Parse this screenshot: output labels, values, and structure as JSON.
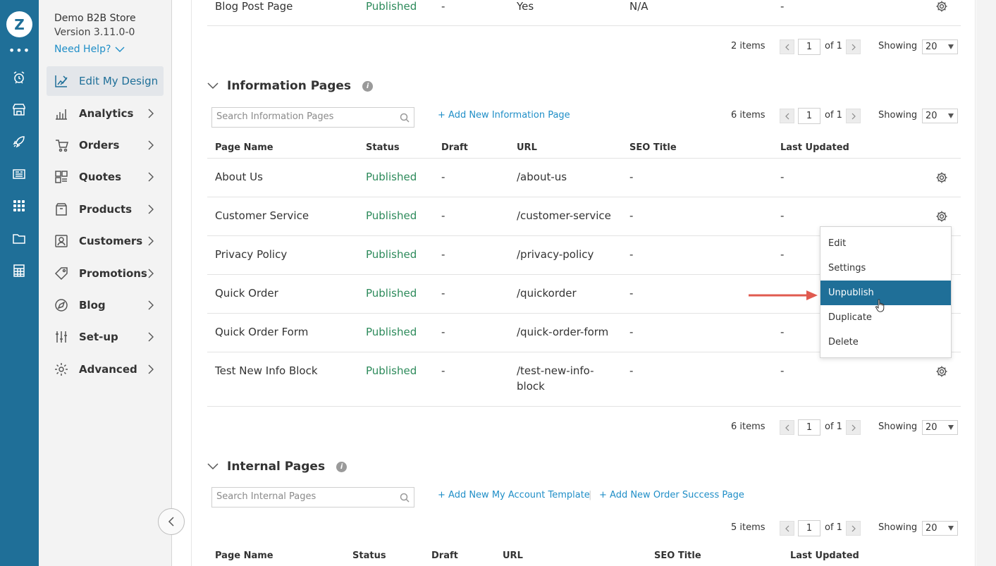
{
  "rail": {
    "logo": "Z",
    "more": "•••",
    "icons": [
      "alarm-icon",
      "storefront-icon",
      "rocket-icon",
      "newspaper-icon",
      "apps-grid-icon",
      "folder-icon",
      "spreadsheet-icon"
    ]
  },
  "sidebar": {
    "store_name": "Demo B2B Store",
    "version": "Version 3.11.0-0",
    "help": "Need Help?",
    "items": [
      {
        "label": "Edit My Design",
        "icon": "design-icon",
        "active": true
      },
      {
        "label": "Analytics",
        "icon": "bar-chart-icon"
      },
      {
        "label": "Orders",
        "icon": "orders-icon"
      },
      {
        "label": "Quotes",
        "icon": "quotes-icon"
      },
      {
        "label": "Products",
        "icon": "box-icon"
      },
      {
        "label": "Customers",
        "icon": "customers-icon"
      },
      {
        "label": "Promotions",
        "icon": "tag-icon"
      },
      {
        "label": "Blog",
        "icon": "blog-icon"
      },
      {
        "label": "Set-up",
        "icon": "sliders-icon"
      },
      {
        "label": "Advanced",
        "icon": "gear-icon"
      }
    ]
  },
  "blog_section": {
    "row": {
      "name": "Blog Post Page",
      "status": "Published",
      "draft": "-",
      "url": "Yes",
      "seo": "N/A",
      "updated": "-"
    },
    "pager": {
      "items": "2 items",
      "page": "1",
      "of": "of 1",
      "showing": "Showing",
      "per_page": "20"
    }
  },
  "info_section": {
    "title": "Information Pages",
    "info_icon": "i",
    "search_placeholder": "Search Information Pages",
    "add_link": "+ Add New Information Page",
    "pager": {
      "items": "6 items",
      "page": "1",
      "of": "of 1",
      "showing": "Showing",
      "per_page": "20"
    },
    "headers": [
      "Page Name",
      "Status",
      "Draft",
      "URL",
      "SEO Title",
      "Last Updated"
    ],
    "rows": [
      {
        "name": "About Us",
        "status": "Published",
        "draft": "-",
        "url": "/about-us",
        "seo": "-",
        "updated": "-"
      },
      {
        "name": "Customer Service",
        "status": "Published",
        "draft": "-",
        "url": "/customer-service",
        "seo": "-",
        "updated": "-"
      },
      {
        "name": "Privacy Policy",
        "status": "Published",
        "draft": "-",
        "url": "/privacy-policy",
        "seo": "-",
        "updated": "-"
      },
      {
        "name": "Quick Order",
        "status": "Published",
        "draft": "-",
        "url": "/quickorder",
        "seo": "-",
        "updated": ""
      },
      {
        "name": "Quick Order Form",
        "status": "Published",
        "draft": "-",
        "url": "/quick-order-form",
        "seo": "-",
        "updated": "-"
      },
      {
        "name": "Test New Info Block",
        "status": "Published",
        "draft": "-",
        "url_line1": "/test-new-info-",
        "url_line2": "block",
        "seo": "-",
        "updated": "-"
      }
    ],
    "bottom_pager": {
      "items": "6 items",
      "page": "1",
      "of": "of 1",
      "showing": "Showing",
      "per_page": "20"
    }
  },
  "internal_section": {
    "title": "Internal Pages",
    "info_icon": "i",
    "search_placeholder": "Search Internal Pages",
    "add_link_1": "+ Add New My Account Template",
    "separator": "|",
    "add_link_2": "+ Add New Order Success Page",
    "pager": {
      "items": "5 items",
      "page": "1",
      "of": "of 1",
      "showing": "Showing",
      "per_page": "20"
    },
    "headers": [
      "Page Name",
      "Status",
      "Draft",
      "URL",
      "SEO Title",
      "Last Updated"
    ]
  },
  "context_menu": {
    "items": [
      "Edit",
      "Settings",
      "Unpublish",
      "Duplicate",
      "Delete"
    ],
    "highlighted": "Unpublish"
  },
  "colors": {
    "rail": "#1f6f98",
    "status": "#2c8a5a",
    "link": "#1f8ec7",
    "highlight": "#1f6f98",
    "arrow": "#e05a4f"
  }
}
